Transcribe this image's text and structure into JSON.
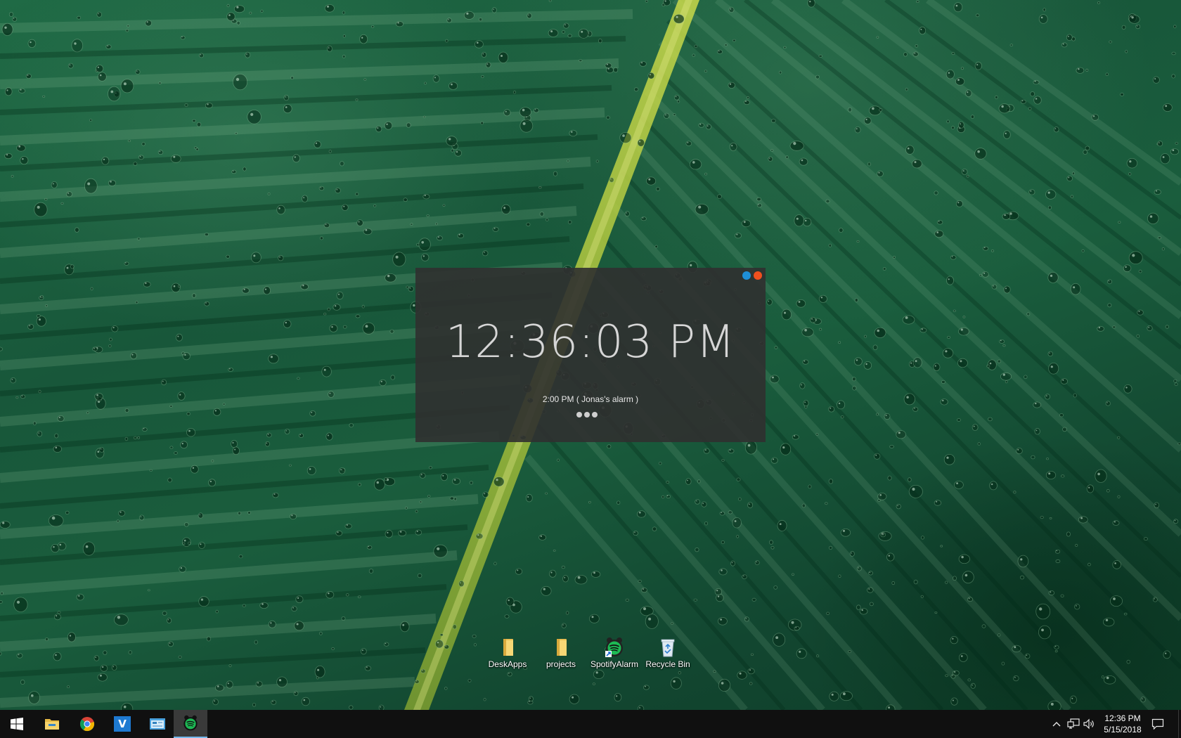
{
  "clock_widget": {
    "time": "12:36:03 PM",
    "next_alarm": "2:00 PM ( Jonas's alarm )",
    "controls": {
      "minimize_color": "#1e8fd6",
      "close_color": "#f0501e"
    }
  },
  "desktop_icons": [
    {
      "label": "DeskApps",
      "icon": "folder-icon"
    },
    {
      "label": "projects",
      "icon": "folder-icon"
    },
    {
      "label": "SpotifyAlarm",
      "icon": "spotify-alarm-shortcut-icon"
    },
    {
      "label": "Recycle Bin",
      "icon": "recycle-bin-icon"
    }
  ],
  "taskbar": {
    "pinned": [
      {
        "name": "Start",
        "icon": "windows-start-icon"
      },
      {
        "name": "File Explorer",
        "icon": "file-explorer-icon"
      },
      {
        "name": "Google Chrome",
        "icon": "chrome-icon"
      },
      {
        "name": "Visual Studio Code",
        "icon": "vscode-icon"
      },
      {
        "name": "Control Panel",
        "icon": "control-panel-icon"
      },
      {
        "name": "SpotifyAlarm",
        "icon": "spotify-alarm-icon",
        "active": true
      }
    ],
    "tray": {
      "time": "12:36 PM",
      "date": "5/15/2018"
    }
  },
  "colors": {
    "accent": "#76b9ed",
    "spotify_green": "#1db954",
    "folder_yellow": "#f2c85b"
  }
}
